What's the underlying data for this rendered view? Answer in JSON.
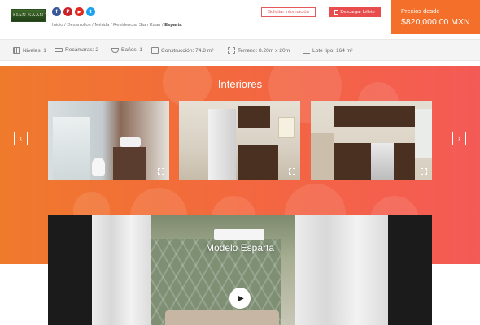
{
  "header": {
    "logo_text": "SIAN KAAN V",
    "social": [
      {
        "name": "facebook-icon",
        "glyph": "f",
        "color": "#3b5998"
      },
      {
        "name": "pinterest-icon",
        "glyph": "P",
        "color": "#cb2027"
      },
      {
        "name": "youtube-icon",
        "glyph": "▶",
        "color": "#e02a20"
      },
      {
        "name": "twitter-icon",
        "glyph": "t",
        "color": "#1da1f2"
      }
    ],
    "breadcrumb": {
      "path": "Inicio / Desarrollos / Mérida / Residencial Sian Kaan / ",
      "current": "Esparta"
    },
    "solicitar_label": "Solicitar información",
    "folleto_label": "Descargar folleto",
    "price_label": "Precios desde",
    "price_value": "$820,000.00 MXN"
  },
  "specs": [
    {
      "icon": "levels-icon",
      "label": "Niveles: 1"
    },
    {
      "icon": "bed-icon",
      "label": "Recámaras: 2"
    },
    {
      "icon": "bath-icon",
      "label": "Baños: 1"
    },
    {
      "icon": "construction-icon",
      "label": "Construcción: 74.8 m²"
    },
    {
      "icon": "land-icon",
      "label": "Terreno: 8.20m x 20m"
    },
    {
      "icon": "lot-icon",
      "label": "Lote tipo: 164 m²"
    }
  ],
  "interiores": {
    "title": "Interiores",
    "prev_glyph": "‹",
    "next_glyph": "›"
  },
  "video": {
    "title": "Modelo Esparta",
    "play_glyph": "▶"
  },
  "colors": {
    "accent_orange": "#f36f2a",
    "accent_red": "#e84c4c"
  }
}
